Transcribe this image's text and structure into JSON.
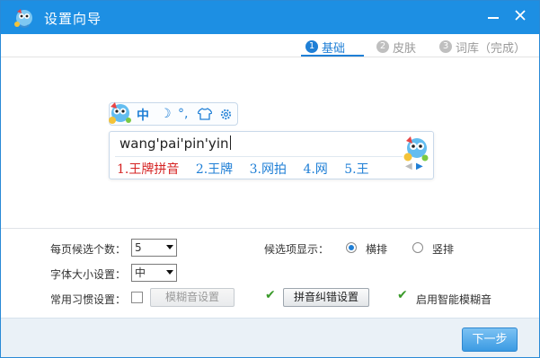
{
  "window": {
    "title": "设置向导",
    "colors": {
      "titlebar": "#1d8fe3",
      "accent": "#1f7fd6",
      "candidate_first": "#d52222"
    }
  },
  "steps": [
    {
      "num": "1",
      "label": "基础",
      "active": true
    },
    {
      "num": "2",
      "label": "皮肤",
      "active": false
    },
    {
      "num": "3",
      "label": "词库（完成）",
      "active": false
    }
  ],
  "preview": {
    "statusbar": {
      "mode": "中",
      "moon_icon": "☽",
      "punct_icon": "°,",
      "skin_icon": "shirt-icon",
      "gear_icon": "gear-icon"
    },
    "composition": "wang'pai'pin'yin",
    "candidates": [
      "1.王牌拼音",
      "2.王牌",
      "3.网拍",
      "4.网",
      "5.王"
    ]
  },
  "settings": {
    "per_page_label": "每页候选个数：",
    "per_page_value": "5",
    "font_size_label": "字体大小设置：",
    "font_size_value": "中",
    "display_label": "候选项显示：",
    "horizontal_label": "横排",
    "vertical_label": "竖排",
    "display_selected": "horizontal",
    "habits_label": "常用习惯设置：",
    "fuzzy_button": "模糊音设置",
    "pinyin_fix_button": "拼音纠错设置",
    "smart_fuzzy_label": "启用智能模糊音"
  },
  "footer": {
    "next_button": "下一步"
  }
}
